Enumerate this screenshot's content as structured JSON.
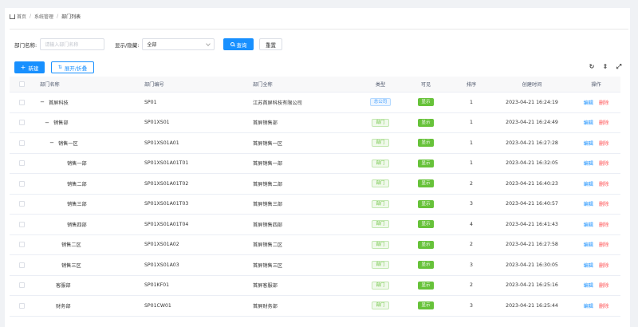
{
  "breadcrumb": {
    "home": "首页",
    "system": "系统管理",
    "current": "部门列表"
  },
  "filters": {
    "name_label": "部门名称:",
    "name_placeholder": "请输入部门名称",
    "visibility_label": "显示/隐藏:",
    "visibility_value": "全部",
    "search_label": "查询",
    "reset_label": "重置"
  },
  "actions": {
    "add_label": "新建",
    "expand_label": "展开/折叠"
  },
  "toolbar_icons": [
    "refresh-icon",
    "column-height-icon",
    "fullscreen-icon"
  ],
  "table": {
    "headers": {
      "name": "部门名称",
      "code": "部门编号",
      "full_name": "部门全称",
      "type": "类型",
      "visible": "可见",
      "sort": "排序",
      "created": "创建时间",
      "ops": "操作"
    },
    "edit_label": "编辑",
    "delete_label": "删除",
    "rows": [
      {
        "name": "首屏科技",
        "code": "SP01",
        "full_name": "江苏首屏科技有限公司",
        "type": "总公司",
        "visible": "显示",
        "sort": "1",
        "created": "2023-04-21 16:24:19"
      },
      {
        "name": "销售部",
        "code": "SP01XS01",
        "full_name": "首屏销售部",
        "type": "部门",
        "visible": "显示",
        "sort": "1",
        "created": "2023-04-21 16:24:49"
      },
      {
        "name": "销售一区",
        "code": "SP01XS01A01",
        "full_name": "首屏销售一区",
        "type": "部门",
        "visible": "显示",
        "sort": "1",
        "created": "2023-04-21 16:27:28"
      },
      {
        "name": "销售一部",
        "code": "SP01XS01A01T01",
        "full_name": "首屏销售一部",
        "type": "部门",
        "visible": "显示",
        "sort": "1",
        "created": "2023-04-21 16:32:05"
      },
      {
        "name": "销售二部",
        "code": "SP01XS01A01T02",
        "full_name": "首屏销售二部",
        "type": "部门",
        "visible": "显示",
        "sort": "2",
        "created": "2023-04-21 16:40:23"
      },
      {
        "name": "销售三部",
        "code": "SP01XS01A01T03",
        "full_name": "首屏销售三部",
        "type": "部门",
        "visible": "显示",
        "sort": "3",
        "created": "2023-04-21 16:40:57"
      },
      {
        "name": "销售四部",
        "code": "SP01XS01A01T04",
        "full_name": "首屏销售四部",
        "type": "部门",
        "visible": "显示",
        "sort": "4",
        "created": "2023-04-21 16:41:43"
      },
      {
        "name": "销售二区",
        "code": "SP01XS01A02",
        "full_name": "首屏销售二区",
        "type": "部门",
        "visible": "显示",
        "sort": "2",
        "created": "2023-04-21 16:27:58"
      },
      {
        "name": "销售三区",
        "code": "SP01XS01A03",
        "full_name": "首屏销售三区",
        "type": "部门",
        "visible": "显示",
        "sort": "3",
        "created": "2023-04-21 16:30:05"
      },
      {
        "name": "客服部",
        "code": "SP01KF01",
        "full_name": "首屏客服部",
        "type": "部门",
        "visible": "显示",
        "sort": "2",
        "created": "2023-04-21 16:25:16"
      },
      {
        "name": "财务部",
        "code": "SP01CW01",
        "full_name": "首屏财务部",
        "type": "部门",
        "visible": "显示",
        "sort": "3",
        "created": "2023-04-21 16:25:44"
      }
    ]
  },
  "colors": {
    "primary": "#1890ff",
    "success": "#67c23a",
    "danger": "#ff4d4f"
  }
}
